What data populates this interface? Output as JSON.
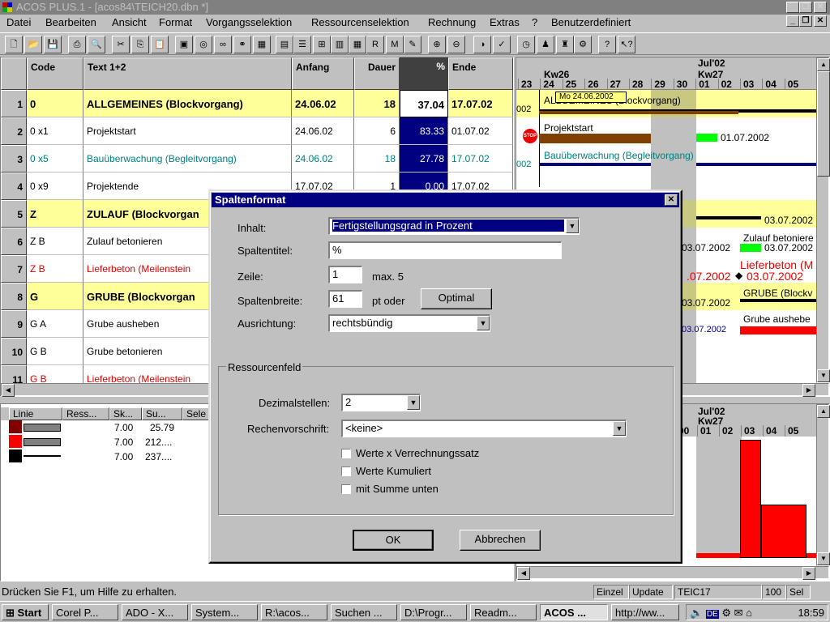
{
  "window": {
    "title": "ACOS PLUS.1 - [acos84\\TEICH20.dbn *]"
  },
  "menu": [
    "Datei",
    "Bearbeiten",
    "Ansicht",
    "Format",
    "Vorgangsselektion",
    "Ressourcenselektion",
    "Rechnung",
    "Extras",
    "?",
    "Benutzerdefiniert"
  ],
  "grid": {
    "columns": [
      "Code",
      "Text 1+2",
      "Anfang",
      "Dauer",
      "%",
      "Ende"
    ],
    "rows": [
      {
        "num": "1",
        "code": "0",
        "text": "ALLGEMEINES (Blockvorgang)",
        "start": "24.06.02",
        "dur": "18",
        "pct": "37.04",
        "end": "17.07.02",
        "style": "block"
      },
      {
        "num": "2",
        "code": "0 x1",
        "text": "Projektstart",
        "start": "24.06.02",
        "dur": "6",
        "pct": "83.33",
        "end": "01.07.02",
        "style": "normal"
      },
      {
        "num": "3",
        "code": "0 x5",
        "text": "Bauüberwachung (Begleitvorgang)",
        "start": "24.06.02",
        "dur": "18",
        "pct": "27.78",
        "end": "17.07.02",
        "style": "teal"
      },
      {
        "num": "4",
        "code": "0 x9",
        "text": "Projektende",
        "start": "17.07.02",
        "dur": "1",
        "pct": "0.00",
        "end": "17.07.02",
        "style": "normal"
      },
      {
        "num": "5",
        "code": "Z",
        "text": "ZULAUF (Blockvorgan",
        "start": "",
        "dur": "",
        "pct": "",
        "end": "",
        "style": "block"
      },
      {
        "num": "6",
        "code": "Z B",
        "text": "Zulauf betonieren",
        "start": "",
        "dur": "",
        "pct": "",
        "end": "",
        "style": "normal"
      },
      {
        "num": "7",
        "code": "Z B",
        "text": "Lieferbeton (Meilenstein",
        "start": "",
        "dur": "",
        "pct": "",
        "end": "",
        "style": "red"
      },
      {
        "num": "8",
        "code": "G",
        "text": "GRUBE (Blockvorgan",
        "start": "",
        "dur": "",
        "pct": "",
        "end": "",
        "style": "block"
      },
      {
        "num": "9",
        "code": "G A",
        "text": "Grube ausheben",
        "start": "",
        "dur": "",
        "pct": "",
        "end": "",
        "style": "normal"
      },
      {
        "num": "10",
        "code": "G B",
        "text": "Grube betonieren",
        "start": "",
        "dur": "",
        "pct": "",
        "end": "",
        "style": "normal"
      },
      {
        "num": "11",
        "code": "G B",
        "text": "Lieferbeton (Meilenstein",
        "start": "",
        "dur": "",
        "pct": "",
        "end": "",
        "style": "red"
      }
    ]
  },
  "gantt": {
    "month": "Jul'02",
    "weeks": [
      "Kw26",
      "Kw27"
    ],
    "days": [
      "23",
      "24",
      "25",
      "26",
      "27",
      "28",
      "29",
      "30",
      "01",
      "02",
      "03",
      "04",
      "05"
    ],
    "tooltip": "Mo  24.06.2002",
    "labels": {
      "r1": "ALLGEMEINES (Blockvorgang)",
      "r1prefix": "002",
      "r2": "Projektstart",
      "r2date": "01.07.2002",
      "r3": "Bauüberwachung (Begleitvorgang)",
      "r3prefix": "002",
      "r5date": "03.07.2002",
      "r6": "Zulauf betoniere",
      "r6a": "03.07.2002",
      "r6b": "03.07.2002",
      "r7": "Lieferbeton (M",
      "r7a": ".07.2002",
      "r7b": "03.07.2002",
      "r8": "GRUBE (Blockv",
      "r8a": "03.07.2002",
      "r9": "Grube aushebe",
      "r9a": "03.07.2002",
      "stop": "STOP"
    }
  },
  "resources": {
    "columns": [
      "Linie",
      "Ress...",
      "Sk...",
      "Su...",
      "Sele"
    ],
    "rows": [
      {
        "sk": "7.00",
        "su": "25.79"
      },
      {
        "sk": "7.00",
        "su": "212...."
      },
      {
        "sk": "7.00",
        "su": "237...."
      }
    ]
  },
  "histogram": {
    "month": "Jul'02",
    "week": "Kw27",
    "days": [
      "00",
      "01",
      "02",
      "03",
      "04",
      "05"
    ]
  },
  "dialog": {
    "title": "Spaltenformat",
    "inhalt_label": "Inhalt:",
    "inhalt_value": "Fertigstellungsgrad in Prozent",
    "spaltentitel_label": "Spaltentitel:",
    "spaltentitel_value": "%",
    "zeile_label": "Zeile:",
    "zeile_value": "1",
    "zeile_hint": "max. 5",
    "breite_label": "Spaltenbreite:",
    "breite_value": "61",
    "breite_hint": "pt oder",
    "optimal_button": "Optimal",
    "ausrichtung_label": "Ausrichtung:",
    "ausrichtung_value": "rechtsbündig",
    "group_title": "Ressourcenfeld",
    "dezimal_label": "Dezimalstellen:",
    "dezimal_value": "2",
    "rechen_label": "Rechenvorschrift:",
    "rechen_value": "<keine>",
    "check1": "Werte x Verrechnungssatz",
    "check2": "Werte Kumuliert",
    "check3": "mit Summe unten",
    "ok": "OK",
    "cancel": "Abbrechen"
  },
  "status": {
    "help": "Drücken Sie F1, um Hilfe zu erhalten.",
    "mode": "Einzel",
    "update": "Update",
    "file": "TEIC17",
    "zoom": "100",
    "sel": "Sel"
  },
  "taskbar": {
    "start": "Start",
    "tasks": [
      "Corel P...",
      "ADO - X...",
      "System...",
      "R:\\acos...",
      "Suchen ...",
      "D:\\Progr...",
      "Readm...",
      "ACOS ...",
      "http://ww..."
    ],
    "clock": "18:59",
    "lang": "DE"
  },
  "colors": {
    "accent": "#000080",
    "block": "#ffff99",
    "teal": "#008080",
    "red": "#ff0000",
    "bar_brown": "#804000",
    "bar_green": "#00ff00"
  }
}
